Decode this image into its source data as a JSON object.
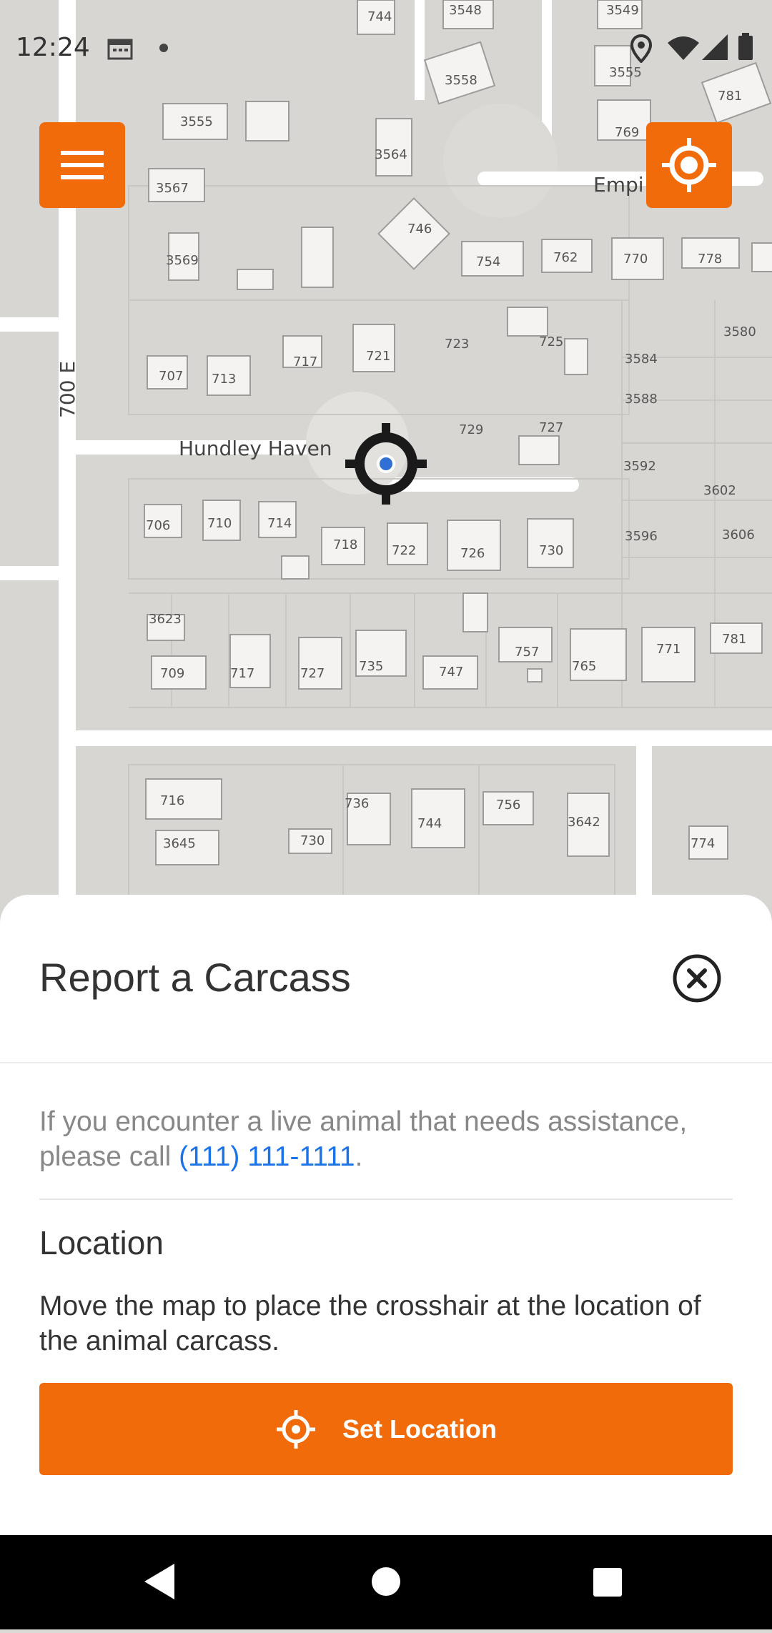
{
  "status_bar": {
    "time": "12:24",
    "icons": [
      "calendar-icon",
      "dot-icon",
      "location-pin-icon",
      "wifi-icon",
      "signal-icon",
      "battery-icon"
    ]
  },
  "map": {
    "streets": [
      "700 E",
      "Hundley Haven",
      "Empi"
    ],
    "addresses": [
      "744",
      "3548",
      "3549",
      "3555",
      "3558",
      "781",
      "3555",
      "3564",
      "769",
      "3567",
      "746",
      "754",
      "762",
      "770",
      "778",
      "3569",
      "723",
      "725",
      "3580",
      "707",
      "713",
      "717",
      "721",
      "3584",
      "3588",
      "729",
      "727",
      "3592",
      "3602",
      "706",
      "710",
      "714",
      "718",
      "722",
      "726",
      "730",
      "3596",
      "3606",
      "3623",
      "709",
      "717",
      "727",
      "735",
      "747",
      "757",
      "765",
      "771",
      "781",
      "716",
      "736",
      "744",
      "756",
      "3642",
      "3645",
      "730",
      "774"
    ]
  },
  "buttons": {
    "menu_icon": "hamburger-menu-icon",
    "locate_icon": "my-location-icon"
  },
  "sheet": {
    "title": "Report a Carcass",
    "info_prefix": "If you encounter a live animal that needs assistance, please call ",
    "phone": "(111) 111-1111",
    "info_suffix": ".",
    "location_heading": "Location",
    "location_desc": "Move the map to place the crosshair at the location of the animal carcass.",
    "set_location_label": "Set Location"
  },
  "colors": {
    "accent": "#f26b0a",
    "link": "#1a73e8"
  }
}
